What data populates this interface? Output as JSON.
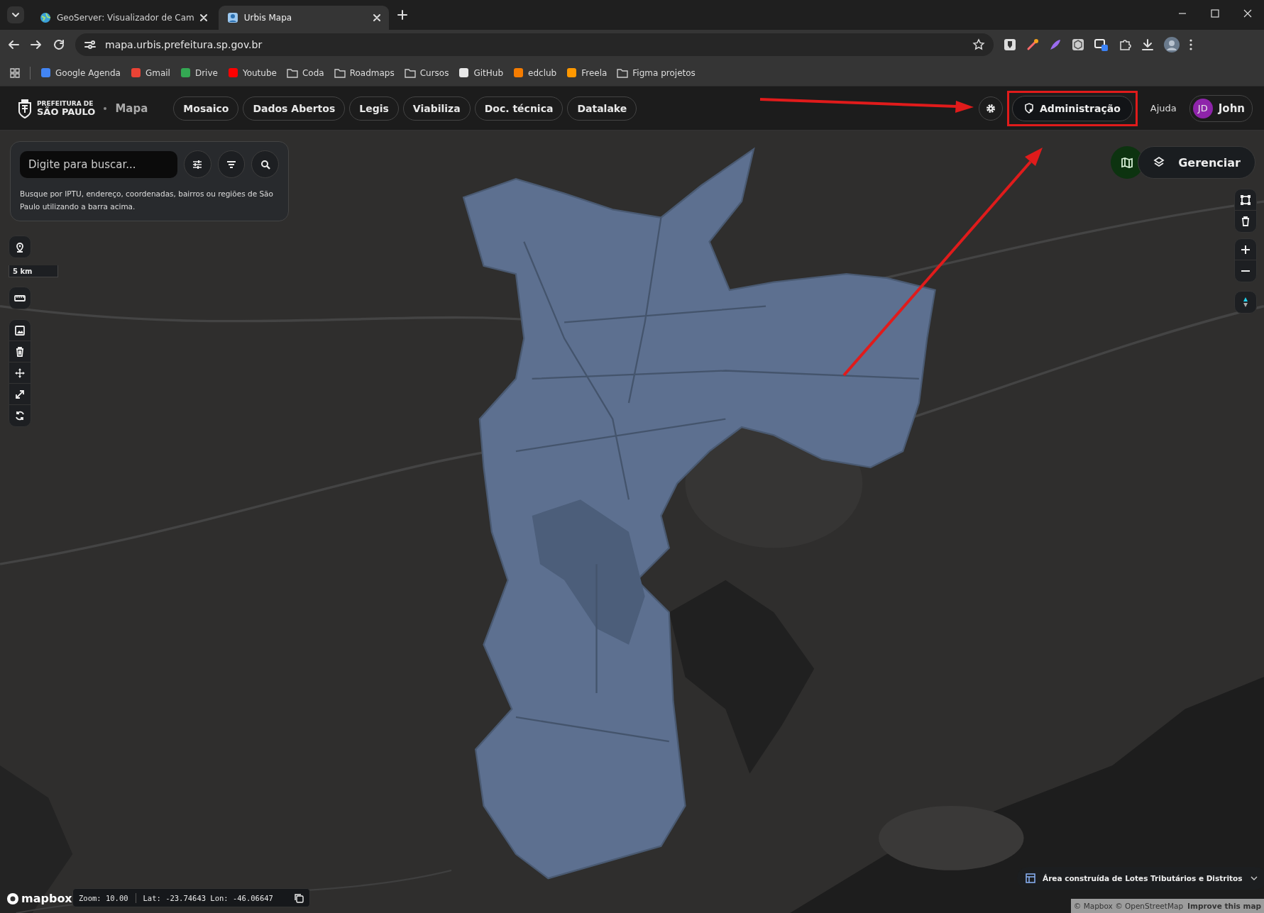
{
  "browser": {
    "tabs": [
      {
        "title": "GeoServer: Visualizador de Cam",
        "selected": false
      },
      {
        "title": "Urbis Mapa",
        "selected": true
      }
    ],
    "address": "mapa.urbis.prefeitura.sp.gov.br",
    "bookmarks": [
      {
        "label": "Google Agenda",
        "kind": "site",
        "color": "#4285f4"
      },
      {
        "label": "Gmail",
        "kind": "site",
        "color": "#ea4335"
      },
      {
        "label": "Drive",
        "kind": "site",
        "color": "#34a853"
      },
      {
        "label": "Youtube",
        "kind": "site",
        "color": "#ff0000"
      },
      {
        "label": "Coda",
        "kind": "folder"
      },
      {
        "label": "Roadmaps",
        "kind": "folder"
      },
      {
        "label": "Cursos",
        "kind": "folder"
      },
      {
        "label": "GitHub",
        "kind": "site",
        "color": "#e8e8e8"
      },
      {
        "label": "edclub",
        "kind": "site",
        "color": "#f57c00"
      },
      {
        "label": "Freela",
        "kind": "site",
        "color": "#ff9800"
      },
      {
        "label": "Figma projetos",
        "kind": "folder"
      }
    ]
  },
  "header": {
    "brand_line1": "PREFEITURA DE",
    "brand_line2": "SÃO PAULO",
    "section": "Mapa",
    "nav": [
      "Mosaico",
      "Dados Abertos",
      "Legis",
      "Viabiliza",
      "Doc. técnica",
      "Datalake"
    ],
    "admin_button": "Administração",
    "help_link": "Ajuda",
    "user": {
      "initials": "JD",
      "name": "John"
    }
  },
  "search": {
    "placeholder": "Digite para buscar...",
    "hint": "Busque por IPTU, endereço, coordenadas, bairros ou regiões de São Paulo utilizando a barra acima."
  },
  "map": {
    "kind": "picture",
    "scale": "5 km",
    "manage_button": "Gerenciar",
    "zoom_reading": "Zoom: 10.00",
    "coordinates": "Lat: -23.74643 Lon: -46.06647",
    "layer": "Área construída de Lotes Tributários e Distritos",
    "logo": "mapbox",
    "attribution": "© Mapbox © OpenStreetMap",
    "improve_link": "Improve this map"
  }
}
